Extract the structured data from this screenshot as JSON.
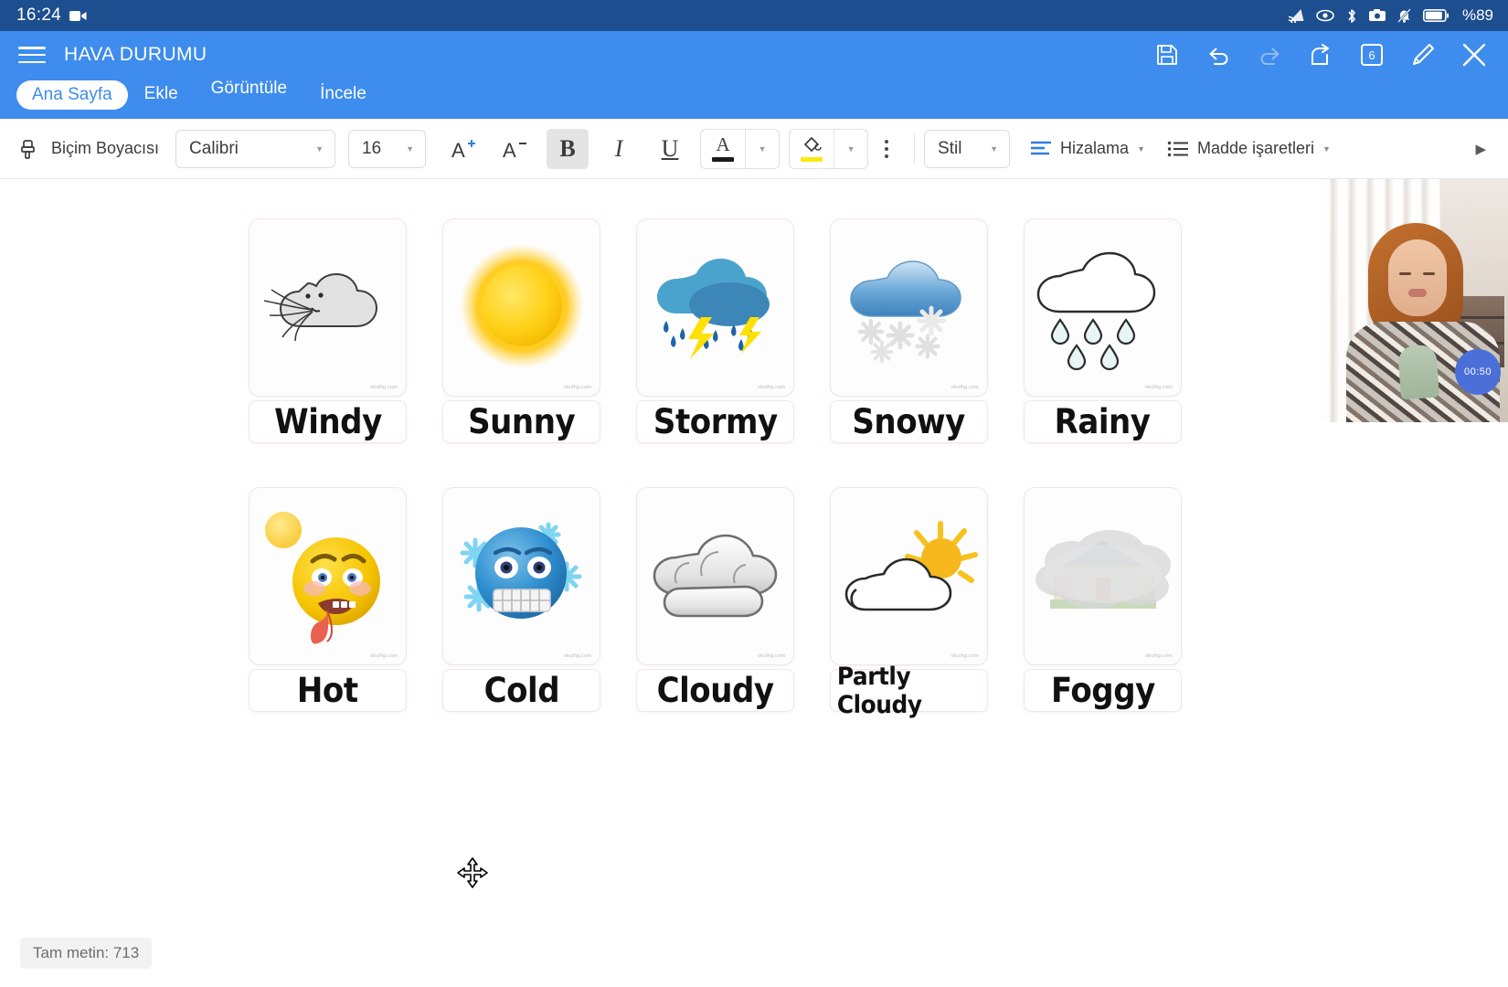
{
  "statusbar": {
    "time": "16:24",
    "battery_text": "%89",
    "icons": [
      "screen-cast-icon",
      "eye-icon",
      "bluetooth-icon",
      "camera-icon",
      "bell-muted-icon",
      "battery-icon"
    ]
  },
  "appbar": {
    "menu_icon": "hamburger-menu-icon",
    "title": "HAVA DURUMU",
    "actions": [
      {
        "name": "save-icon",
        "label": "save"
      },
      {
        "name": "undo-icon",
        "label": "undo"
      },
      {
        "name": "redo-icon",
        "label": "redo"
      },
      {
        "name": "share-icon",
        "label": "share"
      },
      {
        "name": "page-count-icon",
        "label": "6"
      },
      {
        "name": "edit-pen-icon",
        "label": "edit"
      },
      {
        "name": "close-icon",
        "label": "close"
      }
    ],
    "page_count": "6",
    "tabs": [
      {
        "label": "Ana Sayfa",
        "active": true
      },
      {
        "label": "Ekle",
        "active": false
      },
      {
        "label": "Görüntüle",
        "active": false
      },
      {
        "label": "İncele",
        "active": false
      }
    ]
  },
  "ribbon": {
    "format_painter": "Biçim Boyacısı",
    "font_name": "Calibri",
    "font_size": "16",
    "increase_font": "A",
    "decrease_font": "A",
    "bold": "B",
    "italic": "I",
    "underline": "U",
    "font_color": "A",
    "highlight_color": "#ffe812",
    "font_color_bar": "#1a1a1a",
    "style": "Stil",
    "alignment": "Hizalama",
    "bullets": "Madde işaretleri",
    "overflow": "▶"
  },
  "document": {
    "status_text": "Tam metin: 713",
    "watermark": "okulhg.com",
    "cards": [
      {
        "label": "Windy",
        "art": "windy-cloud-blowing"
      },
      {
        "label": "Sunny",
        "art": "sun"
      },
      {
        "label": "Stormy",
        "art": "storm-cloud-rain-lightning"
      },
      {
        "label": "Snowy",
        "art": "snow-cloud-snowflakes"
      },
      {
        "label": "Rainy",
        "art": "rain-cloud-droplets"
      },
      {
        "label": "Hot",
        "art": "hot-face-emoji-sun"
      },
      {
        "label": "Cold",
        "art": "cold-face-emoji-snowflakes"
      },
      {
        "label": "Cloudy",
        "art": "gray-clouds"
      },
      {
        "label": "Partly Cloudy",
        "art": "cloud-with-sun"
      },
      {
        "label": "Foggy",
        "art": "foggy-house"
      }
    ]
  },
  "webcam": {
    "timer": "00:50"
  },
  "colors": {
    "status_bar": "#1d4e8f",
    "app_bar": "#3e8ced",
    "accent": "#3e8ced",
    "card_border": "#f7e3e6"
  }
}
